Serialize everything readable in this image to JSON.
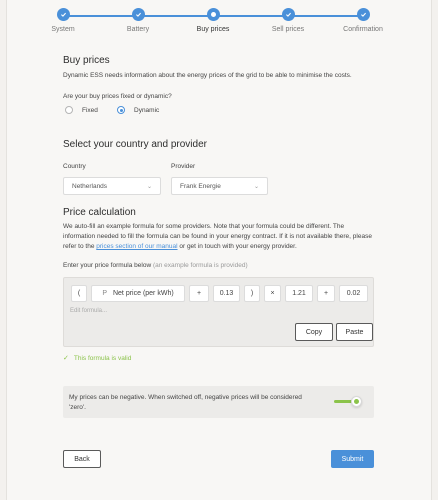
{
  "stepper": {
    "steps": [
      {
        "label": "System",
        "state": "done"
      },
      {
        "label": "Battery",
        "state": "done"
      },
      {
        "label": "Buy prices",
        "state": "current"
      },
      {
        "label": "Sell prices",
        "state": "done"
      },
      {
        "label": "Confirmation",
        "state": "done"
      }
    ]
  },
  "buy_prices": {
    "title": "Buy prices",
    "description": "Dynamic ESS needs information about the energy prices of the grid to be able to minimise the costs.",
    "question": "Are your buy prices fixed or dynamic?",
    "options": [
      {
        "label": "Fixed",
        "selected": false
      },
      {
        "label": "Dynamic",
        "selected": true
      }
    ]
  },
  "provider": {
    "title": "Select your country and provider",
    "country_label": "Country",
    "country_value": "Netherlands",
    "provider_label": "Provider",
    "provider_value": "Frank Energie"
  },
  "price_calc": {
    "title": "Price calculation",
    "desc_1": "We auto-fill an example formula for some providers. Note that your formula could be different. The information needed to fill the formula can be found in your energy contract. If it is not available there, please refer to the",
    "desc_link": "prices section of our manual",
    "desc_2": "or get in touch with your energy provider.",
    "formula_label": "Enter your price formula below",
    "formula_hint": "(an example formula is provided)",
    "tokens": [
      "(",
      "Net price (per kWh)",
      "+",
      "0.13",
      ")",
      "×",
      "1.21",
      "+",
      "0.02"
    ],
    "token_prefix": "P",
    "edit_placeholder": "Edit formula...",
    "copy_label": "Copy",
    "paste_label": "Paste",
    "valid_text": "This formula is valid"
  },
  "negative": {
    "text": "My prices can be negative. When switched off, negative prices will be considered 'zero'.",
    "enabled": true
  },
  "footer": {
    "back_label": "Back",
    "submit_label": "Submit"
  },
  "colors": {
    "accent": "#4a90d9",
    "valid": "#8bc34a"
  }
}
